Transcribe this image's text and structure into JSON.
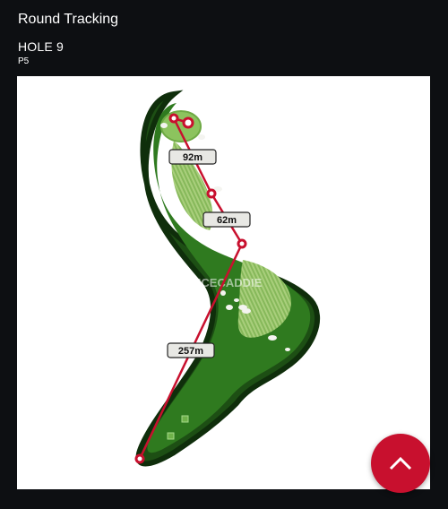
{
  "header": {
    "title": "Round Tracking",
    "hole": "HOLE 9",
    "par": "P5"
  },
  "map": {
    "watermark": "VOICECADDIE",
    "distances": [
      {
        "label": "92m"
      },
      {
        "label": "62m"
      },
      {
        "label": "257m"
      }
    ]
  },
  "nav": {
    "prev_icon": "chevron-left-icon",
    "next_icon": "chevron-right-icon"
  },
  "fab": {
    "icon": "chevron-up-icon",
    "color": "#c8102e"
  },
  "colors": {
    "background": "#0d0f12",
    "fairway": "#2f7a1f",
    "rough": "#1d4f14",
    "shot_line": "#c8102e"
  }
}
